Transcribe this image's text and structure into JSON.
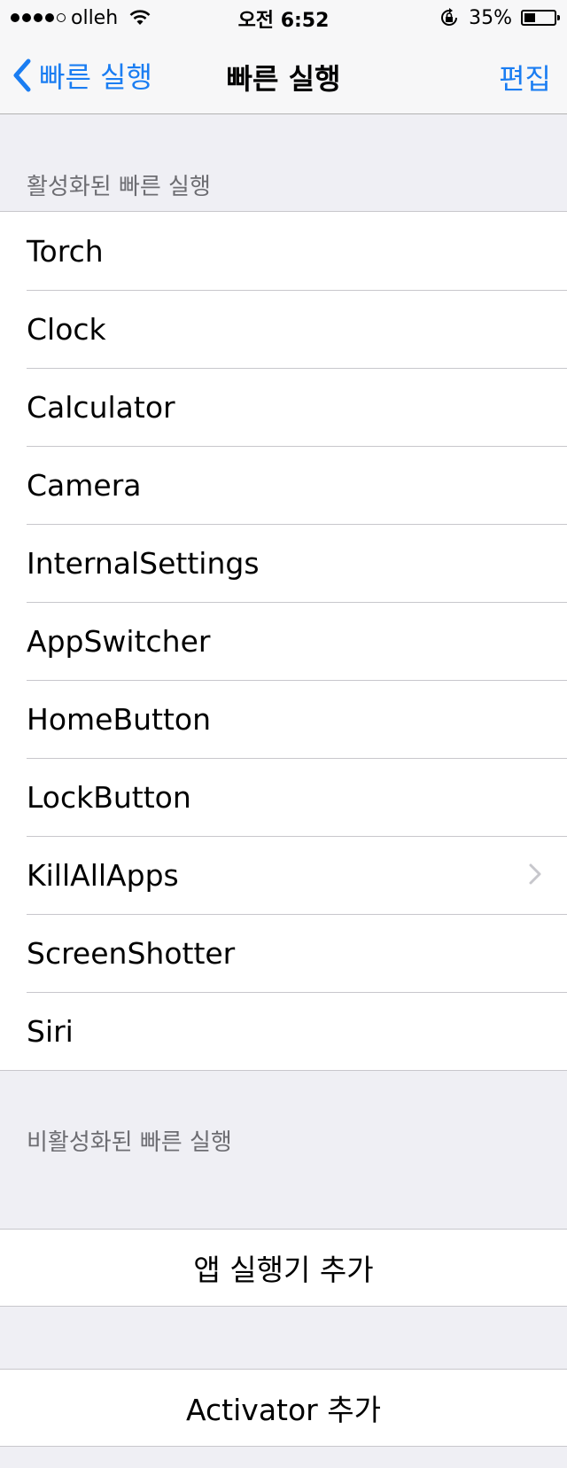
{
  "status_bar": {
    "carrier": "olleh",
    "time": "오전 6:52",
    "battery": "35%",
    "signal_bars": 4,
    "signal_total": 5,
    "battery_level_percent": 35
  },
  "nav": {
    "back_label": "빠른 실행",
    "title": "빠른 실행",
    "edit_label": "편집"
  },
  "active_section": {
    "header": "활성화된 빠른 실행",
    "items": [
      {
        "label": "Torch"
      },
      {
        "label": "Clock"
      },
      {
        "label": "Calculator"
      },
      {
        "label": "Camera"
      },
      {
        "label": "InternalSettings"
      },
      {
        "label": "AppSwitcher"
      },
      {
        "label": "HomeButton"
      },
      {
        "label": "LockButton"
      },
      {
        "label": "KillAllApps",
        "has_chevron": true
      },
      {
        "label": "ScreenShotter"
      },
      {
        "label": "Siri"
      }
    ]
  },
  "inactive_section": {
    "header": "비활성화된 빠른 실행"
  },
  "buttons": {
    "add_app_launcher": "앱 실행기 추가",
    "add_activator": "Activator 추가"
  }
}
